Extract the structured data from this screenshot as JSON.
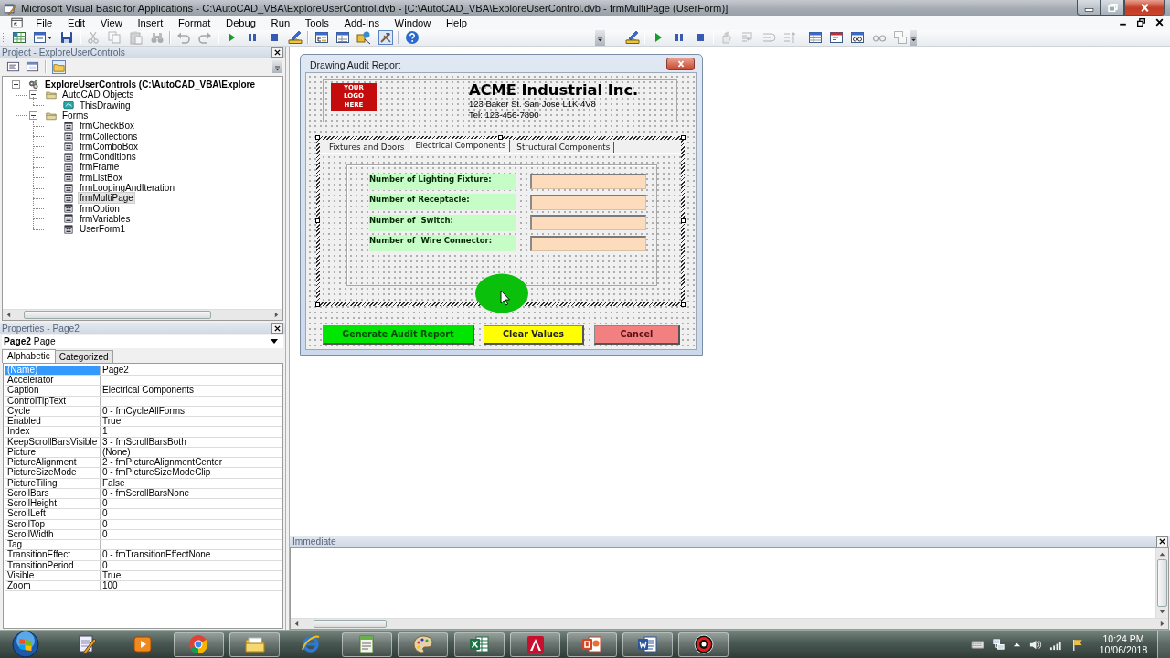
{
  "window": {
    "title": "Microsoft Visual Basic for Applications - C:\\AutoCAD_VBA\\ExploreUserControl.dvb - [C:\\AutoCAD_VBA\\ExploreUserControl.dvb - frmMultiPage (UserForm)]"
  },
  "menu": [
    "File",
    "Edit",
    "View",
    "Insert",
    "Format",
    "Debug",
    "Run",
    "Tools",
    "Add-Ins",
    "Window",
    "Help"
  ],
  "toolbars": [
    [
      [
        {
          "kind": "sheet",
          "disabled": false,
          "pressed": false
        },
        {
          "kind": "form",
          "disabled": false,
          "pressed": false
        },
        {
          "kind": "save",
          "disabled": false,
          "pressed": false
        }
      ],
      [
        {
          "kind": "cut",
          "disabled": true,
          "pressed": false
        },
        {
          "kind": "copy",
          "disabled": true,
          "pressed": false
        },
        {
          "kind": "paste",
          "disabled": true,
          "pressed": false
        },
        {
          "kind": "find",
          "disabled": true,
          "pressed": false
        }
      ],
      [
        {
          "kind": "undo",
          "disabled": true,
          "pressed": false
        },
        {
          "kind": "redo",
          "disabled": true,
          "pressed": false
        }
      ],
      [
        {
          "kind": "run",
          "disabled": false,
          "pressed": false
        },
        {
          "kind": "pause",
          "disabled": false,
          "pressed": false
        },
        {
          "kind": "stop",
          "disabled": false,
          "pressed": false
        },
        {
          "kind": "design",
          "disabled": false,
          "pressed": false
        }
      ],
      [
        {
          "kind": "project",
          "disabled": false,
          "pressed": false
        },
        {
          "kind": "properties",
          "disabled": false,
          "pressed": false
        },
        {
          "kind": "browser",
          "disabled": false,
          "pressed": false
        },
        {
          "kind": "toolbox",
          "disabled": false,
          "pressed": true
        }
      ],
      [
        {
          "kind": "help",
          "disabled": false,
          "pressed": false
        }
      ]
    ],
    [
      [
        {
          "kind": "design",
          "disabled": false,
          "pressed": false
        }
      ],
      [
        {
          "kind": "run",
          "disabled": false,
          "pressed": false
        },
        {
          "kind": "pause",
          "disabled": false,
          "pressed": false
        },
        {
          "kind": "stop",
          "disabled": false,
          "pressed": false
        }
      ],
      [
        {
          "kind": "breakpoint",
          "disabled": true,
          "pressed": false
        },
        {
          "kind": "stepinto",
          "disabled": true,
          "pressed": false
        },
        {
          "kind": "stepover",
          "disabled": true,
          "pressed": false
        },
        {
          "kind": "stepout",
          "disabled": true,
          "pressed": false
        }
      ],
      [
        {
          "kind": "locals",
          "disabled": false,
          "pressed": false
        },
        {
          "kind": "immediate",
          "disabled": false,
          "pressed": false
        },
        {
          "kind": "watch",
          "disabled": false,
          "pressed": false
        },
        {
          "kind": "quickwatch",
          "disabled": true,
          "pressed": false
        },
        {
          "kind": "callstack",
          "disabled": true,
          "pressed": false
        }
      ]
    ]
  ],
  "project_pane": {
    "title": "Project - ExploreUserControls",
    "tools": [
      {
        "kind": "code",
        "pressed": false
      },
      {
        "kind": "object",
        "pressed": false
      },
      {
        "kind": "folders",
        "pressed": true
      }
    ],
    "tree": [
      {
        "label": "ExploreUserControls (C:\\AutoCAD_VBA\\Explore",
        "kind": "project",
        "expanded": true,
        "selected": false,
        "children": [
          {
            "label": "AutoCAD Objects",
            "kind": "folder",
            "expanded": true,
            "selected": false,
            "children": [
              {
                "label": "ThisDrawing",
                "kind": "drawing",
                "selected": false
              }
            ]
          },
          {
            "label": "Forms",
            "kind": "folder",
            "expanded": true,
            "selected": false,
            "children": [
              {
                "label": "frmCheckBox",
                "kind": "form",
                "selected": false
              },
              {
                "label": "frmCollections",
                "kind": "form",
                "selected": false
              },
              {
                "label": "frmComboBox",
                "kind": "form",
                "selected": false
              },
              {
                "label": "frmConditions",
                "kind": "form",
                "selected": false
              },
              {
                "label": "frmFrame",
                "kind": "form",
                "selected": false
              },
              {
                "label": "frmListBox",
                "kind": "form",
                "selected": false
              },
              {
                "label": "frmLoopingAndIteration",
                "kind": "form",
                "selected": false
              },
              {
                "label": "frmMultiPage",
                "kind": "form",
                "selected": true
              },
              {
                "label": "frmOption",
                "kind": "form",
                "selected": false
              },
              {
                "label": "frmVariables",
                "kind": "form",
                "selected": false
              },
              {
                "label": "UserForm1",
                "kind": "form",
                "selected": false
              }
            ]
          }
        ]
      }
    ]
  },
  "properties_pane": {
    "title": "Properties - Page2",
    "object": "**Page2** Page",
    "tabs": [
      {
        "label": "Alphabetic",
        "selected": true
      },
      {
        "label": "Categorized",
        "selected": false
      }
    ],
    "rows": [
      {
        "name": "(Name)",
        "value": "Page2",
        "selected": true
      },
      {
        "name": "Accelerator",
        "selected": false
      },
      {
        "name": "Caption",
        "value": "Electrical Components",
        "selected": false
      },
      {
        "name": "ControlTipText",
        "selected": false
      },
      {
        "name": "Cycle",
        "value": "0 - fmCycleAllForms",
        "selected": false
      },
      {
        "name": "Enabled",
        "value": "True",
        "selected": false
      },
      {
        "name": "Index",
        "value": "1",
        "selected": false
      },
      {
        "name": "KeepScrollBarsVisible",
        "value": "3 - fmScrollBarsBoth",
        "selected": false
      },
      {
        "name": "Picture",
        "value": "(None)",
        "selected": false
      },
      {
        "name": "PictureAlignment",
        "value": "2 - fmPictureAlignmentCenter",
        "selected": false
      },
      {
        "name": "PictureSizeMode",
        "value": "0 - fmPictureSizeModeClip",
        "selected": false
      },
      {
        "name": "PictureTiling",
        "value": "False",
        "selected": false
      },
      {
        "name": "ScrollBars",
        "value": "0 - fmScrollBarsNone",
        "selected": false
      },
      {
        "name": "ScrollHeight",
        "value": "0",
        "selected": false
      },
      {
        "name": "ScrollLeft",
        "value": "0",
        "selected": false
      },
      {
        "name": "ScrollTop",
        "value": "0",
        "selected": false
      },
      {
        "name": "ScrollWidth",
        "value": "0",
        "selected": false
      },
      {
        "name": "Tag",
        "selected": false
      },
      {
        "name": "TransitionEffect",
        "value": "0 - fmTransitionEffectNone",
        "selected": false
      },
      {
        "name": "TransitionPeriod",
        "value": "0",
        "selected": false
      },
      {
        "name": "Visible",
        "value": "True",
        "selected": false
      },
      {
        "name": "Zoom",
        "value": "100",
        "selected": false
      }
    ]
  },
  "form": {
    "title": "Drawing Audit Report",
    "logo": "YOUR LOGO HERE",
    "company": "ACME Industrial Inc.",
    "address": "123 Baker St. San Jose L1K 4V8",
    "phone": "Tel: 123-456-7890",
    "multipage": {
      "selected": true,
      "tabs": [
        {
          "label": "Fixtures and Doors",
          "selected": false
        },
        {
          "label": "Electrical Components",
          "selected": true
        },
        {
          "label": "Structural Components",
          "selected": false
        }
      ],
      "fields": [
        {
          "label": "Number of Lighting Fixture:"
        },
        {
          "label": "Number of Receptacle:"
        },
        {
          "label": "Number of  Switch:"
        },
        {
          "label": "Number of  Wire Connector:"
        }
      ]
    },
    "buttons": [
      {
        "label": "Generate Audit Report",
        "color": "#00e600"
      },
      {
        "label": "Clear Values",
        "color": "#ffff00"
      },
      {
        "label": "Cancel",
        "color": "#f28080"
      }
    ]
  },
  "immediate": {
    "title": "Immediate"
  },
  "taskbar": {
    "apps": [
      {
        "kind": "pencil",
        "running": false
      },
      {
        "kind": "media",
        "running": false
      },
      {
        "kind": "ring",
        "running": true
      },
      {
        "kind": "folder",
        "running": true
      },
      {
        "kind": "globe",
        "running": false
      },
      {
        "kind": "notepad",
        "running": true
      },
      {
        "kind": "palette",
        "running": true
      },
      {
        "kind": "grid",
        "running": true
      },
      {
        "kind": "triangle",
        "running": true
      },
      {
        "kind": "slides",
        "running": true
      },
      {
        "kind": "document",
        "running": true
      },
      {
        "kind": "record",
        "running": true
      }
    ],
    "time": "10:24 PM",
    "date": "10/06/2018"
  }
}
